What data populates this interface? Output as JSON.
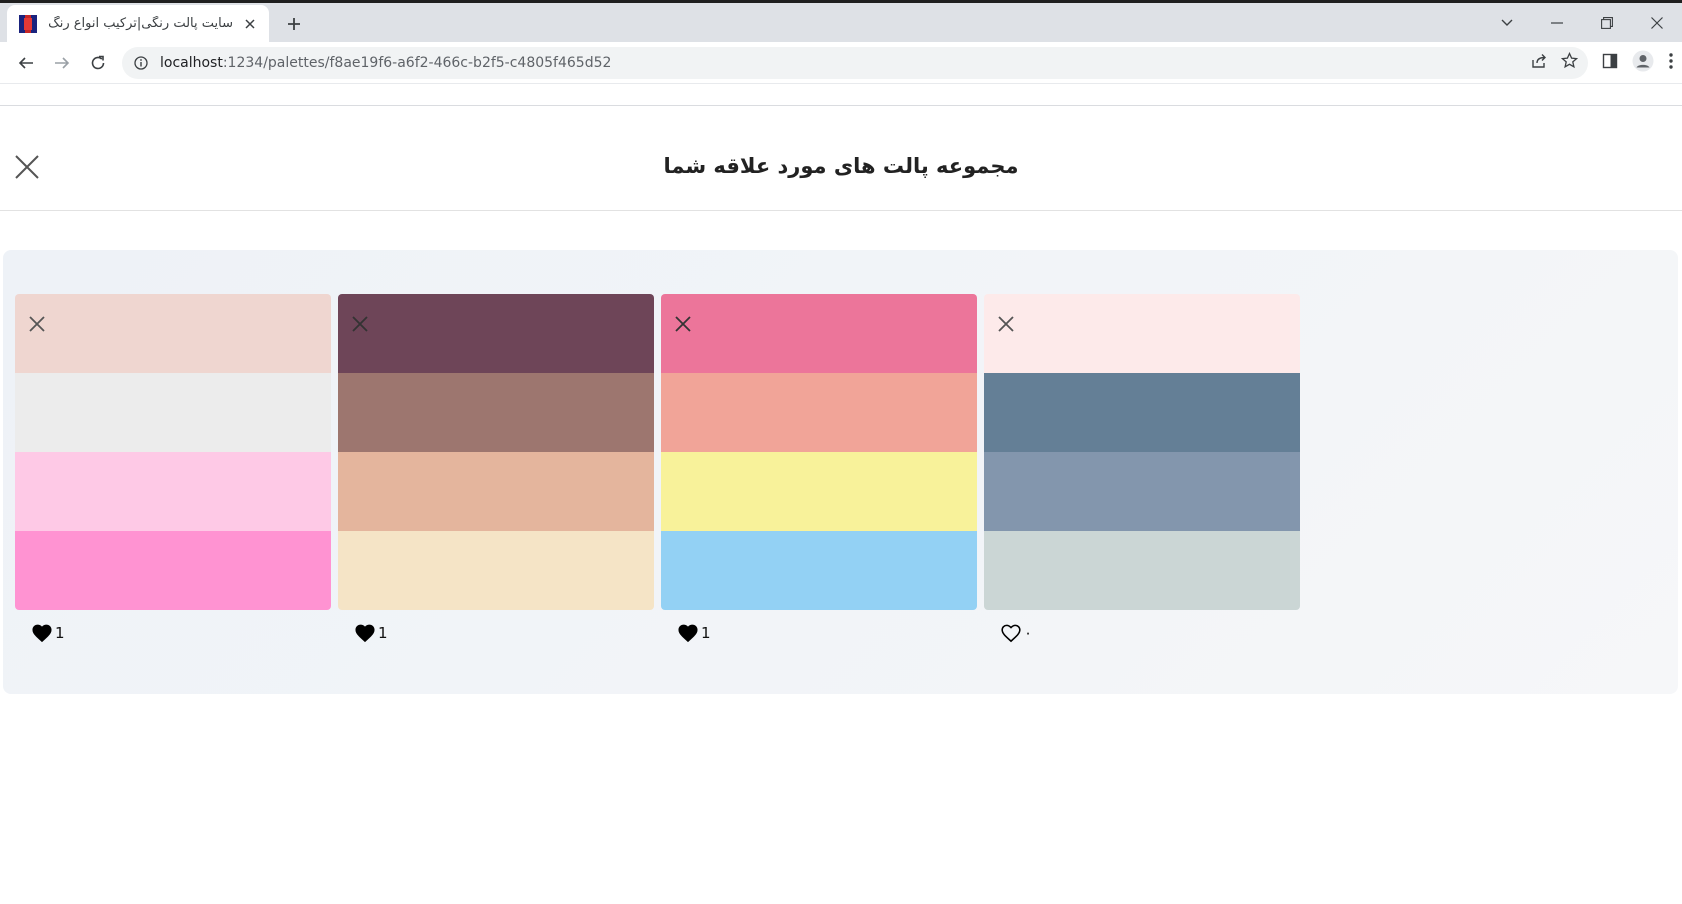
{
  "browser": {
    "tab_title": "سایت پالت رنگی|ترکیب انواع رنگ ها",
    "url_host": "localhost",
    "url_path": ":1234/palettes/f8ae19f6-a6f2-466c-b2f5-c4805f465d52"
  },
  "page": {
    "title": "مجموعه پالت های مورد علاقه شما"
  },
  "palettes": [
    {
      "colors": [
        "#efd6d0",
        "#ececec",
        "#fec9e6",
        "#ff93d2"
      ],
      "likes": "1",
      "liked": true
    },
    {
      "colors": [
        "#6e4558",
        "#9d766f",
        "#e4b59d",
        "#f5e4c6"
      ],
      "likes": "1",
      "liked": true
    },
    {
      "colors": [
        "#ec759a",
        "#f1a498",
        "#f8f29a",
        "#93d1f4"
      ],
      "likes": "1",
      "liked": true
    },
    {
      "colors": [
        "#fdeaea",
        "#647f96",
        "#8396ad",
        "#cbd6d5"
      ],
      "likes": "٠",
      "liked": false
    }
  ],
  "colors": {
    "accent": "#202124",
    "panel_bg": "#eef2f7"
  }
}
